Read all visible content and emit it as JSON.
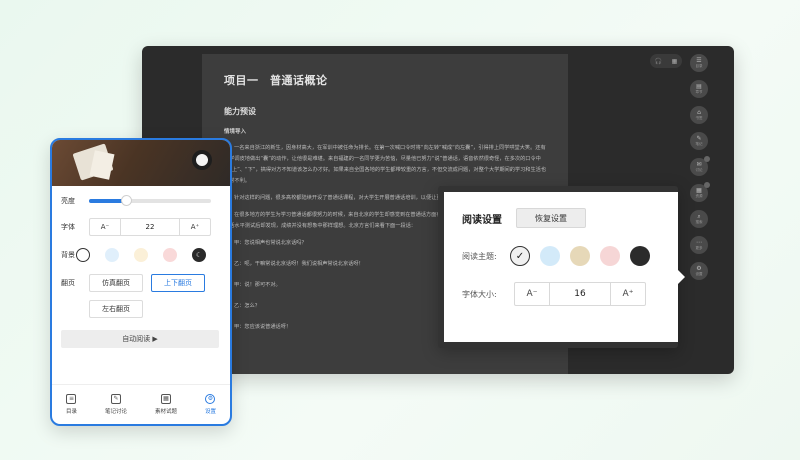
{
  "desktop": {
    "page": {
      "title": "项目一　普通话概论",
      "section": "能力预设",
      "subsection": "情境导入",
      "paragraphs": [
        "一名来自浙江的新生，因身材高大，在军训中被任命为排长。在第一次喊口令时将“向左转”喊成“向左囊”，引得排上同学哄堂大笑。还有同学调皮地做出“囊”的动作，让他很是难堪。来自福建的一名同学更为苦恼，尽量他已努力“说”普通话，语音依然很奇怪，在多次的口令中将“上”、“下”，搞得对方不知道该怎么办才好。如果来自全国各地的学生都带较重的方言，不但交流成问题，对整个大学期间的学习和生活也非常不利。",
        "针对这样的问题，很多高校都陆续开设了普通话课程，对大学生开展普通话培训，以便让更多的大学生提高普通话能力。",
        "在很多地方的学生为学习普通话都很努力的时候，来自北京的学生却感觉到在普通话方面有优势，最能标准的普通话。同事到我们参加普通话水平测试后却发现，成绩并没有想象中那样理想。北京方言们来看下面一段话："
      ],
      "dialogue": [
        "甲：您说相声也常说北京话吗？",
        "乙：呃，干嘛常说北京话呀！我们说相声常说北京话呀！",
        "甲：说！那可不对。",
        "乙：怎么？",
        "甲：您应该说普通话呀！"
      ]
    },
    "top_controls": [
      "headphone-icon",
      "grid-icon"
    ],
    "rail": [
      {
        "icon": "menu-icon",
        "glyph": "☰",
        "label": "目录"
      },
      {
        "icon": "chapter-icon",
        "glyph": "▤",
        "label": "章节"
      },
      {
        "icon": "bookmark-icon",
        "glyph": "⌂",
        "label": "书签"
      },
      {
        "icon": "note-icon",
        "glyph": "✎",
        "label": "笔记"
      },
      {
        "icon": "discuss-icon",
        "glyph": "✉",
        "label": "讨论"
      },
      {
        "icon": "resource-icon",
        "glyph": "▦",
        "label": "资源"
      },
      {
        "icon": "search-icon",
        "glyph": "⌕",
        "label": "搜索"
      },
      {
        "icon": "more-icon",
        "glyph": "⋯",
        "label": "更多"
      },
      {
        "icon": "settings-icon",
        "glyph": "⚙",
        "label": "设置"
      }
    ]
  },
  "popover": {
    "title": "阅读设置",
    "reset_label": "恢复设置",
    "theme_label": "阅读主题:",
    "font_label": "字体大小:",
    "themes": [
      {
        "color": "#f1f1f1",
        "selected": true,
        "mark": "✓"
      },
      {
        "color": "#d3eaf9",
        "selected": false,
        "mark": ""
      },
      {
        "color": "#e6d8b8",
        "selected": false,
        "mark": ""
      },
      {
        "color": "#f6d6d6",
        "selected": false,
        "mark": ""
      },
      {
        "color": "#2b2b2b",
        "selected": false,
        "mark": ""
      }
    ],
    "font_dec": "A⁻",
    "font_value": "16",
    "font_inc": "A⁺"
  },
  "mobile": {
    "brightness_label": "亮度",
    "brightness_value": 0.3,
    "font_label": "字体",
    "font_dec": "A⁻",
    "font_value": "22",
    "font_inc": "A⁺",
    "bg_label": "背景",
    "bg_swatches": [
      {
        "color": "#ffffff",
        "border": "#333333",
        "mark": ""
      },
      {
        "color": "#e0effb",
        "border": "#e0effb",
        "mark": ""
      },
      {
        "color": "#fbf0d8",
        "border": "#fbf0d8",
        "mark": ""
      },
      {
        "color": "#f9d9d9",
        "border": "#f9d9d9",
        "mark": ""
      },
      {
        "color": "#2a2a2a",
        "border": "#2a2a2a",
        "mark": "☾"
      }
    ],
    "paging_label": "翻页",
    "paging_options": [
      "仿真翻页",
      "上下翻页",
      "左右翻页"
    ],
    "paging_active": 1,
    "auto_read_label": "自动阅读 ▶",
    "nav": [
      {
        "icon": "toc-icon",
        "glyph": "≡",
        "label": "目录"
      },
      {
        "icon": "notes-icon",
        "glyph": "✎",
        "label": "笔记讨论"
      },
      {
        "icon": "materials-icon",
        "glyph": "▦",
        "label": "素材试题"
      },
      {
        "icon": "settings-icon",
        "glyph": "⚙",
        "label": "设置"
      }
    ],
    "nav_active": 3,
    "accent": "#2a7be0"
  }
}
